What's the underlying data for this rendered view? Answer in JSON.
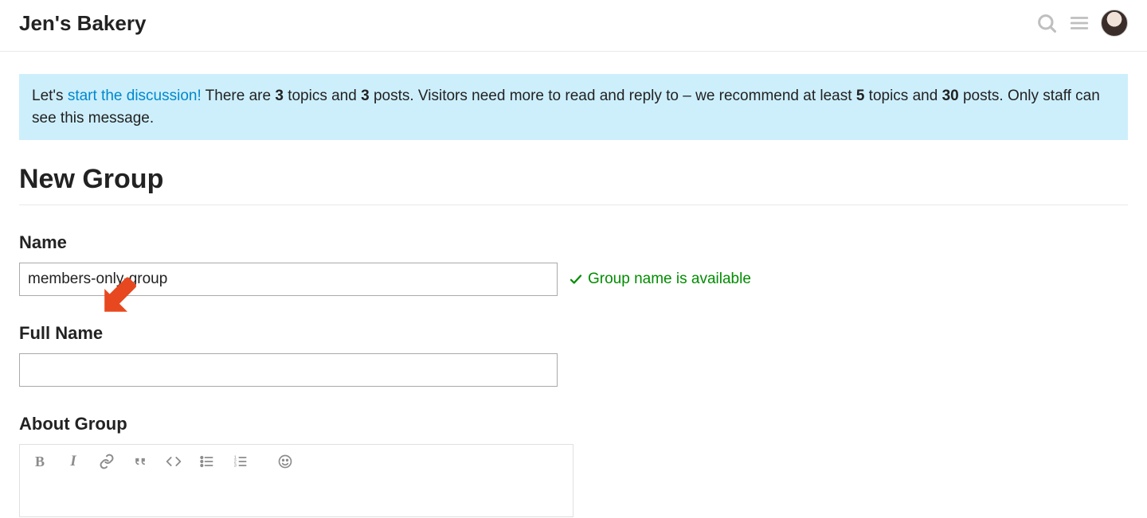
{
  "header": {
    "site_title": "Jen's Bakery"
  },
  "banner": {
    "prefix": "Let's ",
    "link_text": "start the discussion!",
    "mid1": " There are ",
    "topics": "3",
    "mid2": " topics and ",
    "posts": "3",
    "mid3": " posts. Visitors need more to read and reply to – we recommend at least ",
    "rec_topics": "5",
    "mid4": " topics and ",
    "rec_posts": "30",
    "mid5": " posts. Only staff can see this message."
  },
  "page_title": "New Group",
  "form": {
    "name_label": "Name",
    "name_value": "members-only-group",
    "name_availability": "Group name is available",
    "full_name_label": "Full Name",
    "full_name_value": "",
    "about_label": "About Group"
  }
}
